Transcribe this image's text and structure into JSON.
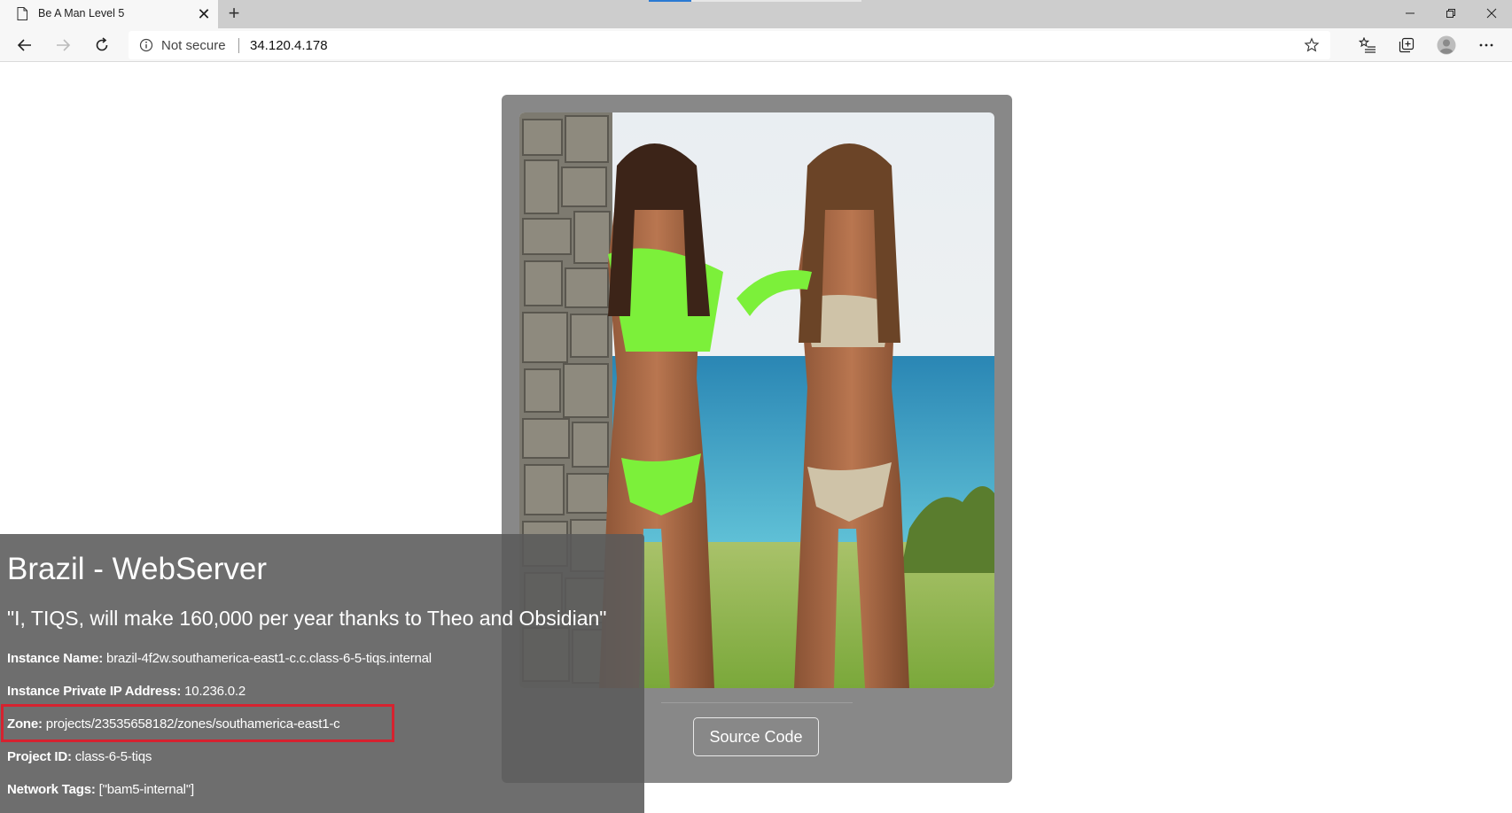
{
  "browser": {
    "tab_title": "Be A Man Level 5",
    "security_label": "Not secure",
    "url": "34.120.4.178",
    "colors": {
      "tab_active": "#f7f7f7",
      "tabbar": "#cdcdcd",
      "loading_accent": "#2a7ad3"
    }
  },
  "page": {
    "heading": "Brazil - WebServer",
    "quote": "\"I, TIQS, will make 160,000 per year thanks to Theo and Obsidian\"",
    "fields": {
      "instance_name": {
        "label": "Instance Name:",
        "value": "brazil-4f2w.southamerica-east1-c.c.class-6-5-tiqs.internal"
      },
      "private_ip": {
        "label": "Instance Private IP Address:",
        "value": "10.236.0.2"
      },
      "zone": {
        "label": "Zone:",
        "value": "projects/23535658182/zones/southamerica-east1-c"
      },
      "project_id": {
        "label": "Project ID:",
        "value": "class-6-5-tiqs"
      },
      "network_tags": {
        "label": "Network Tags:",
        "value": "[\"bam5-internal\"]"
      }
    },
    "source_button_label": "Source Code",
    "colors": {
      "card": "#888888",
      "info_panel": "#5a5a5a",
      "highlight_box": "#d6222f"
    }
  }
}
